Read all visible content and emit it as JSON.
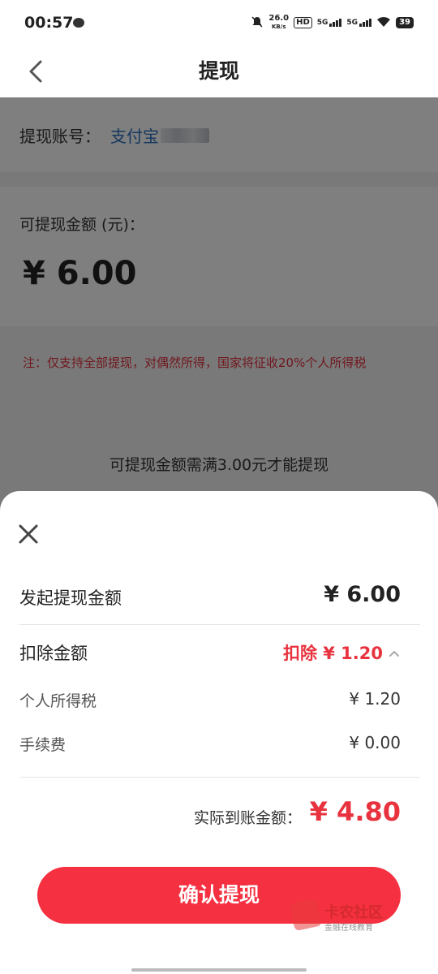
{
  "status_bar": {
    "time": "00:57",
    "net_speed_value": "26.0",
    "net_speed_unit": "KB/s",
    "hd": "HD",
    "sim1": "5G",
    "sim2": "5G",
    "battery": "39"
  },
  "nav": {
    "title": "提现"
  },
  "page": {
    "account_label": "提现账号：",
    "account_value": "支付宝",
    "amount_label": "可提现金额 (元)：",
    "amount_value": "¥ 6.00",
    "note": "注：仅支持全部提现，对偶然所得，国家将征收20%个人所得税",
    "min_note": "可提现金额需满3.00元才能提现"
  },
  "sheet": {
    "initiate_label": "发起提现金额",
    "initiate_value": "¥ 6.00",
    "deduct_label": "扣除金额",
    "deduct_value": "扣除 ¥ 1.20",
    "tax_label": "个人所得税",
    "tax_value": "¥ 1.20",
    "fee_label": "手续费",
    "fee_value": "¥ 0.00",
    "final_label": "实际到账金额：",
    "final_value": "¥ 4.80",
    "confirm_label": "确认提现"
  },
  "watermark": {
    "title": "卡农社区",
    "subtitle": "金融在线教育"
  },
  "colors": {
    "accent_red": "#f53040",
    "account_blue": "#2a6fbf"
  }
}
